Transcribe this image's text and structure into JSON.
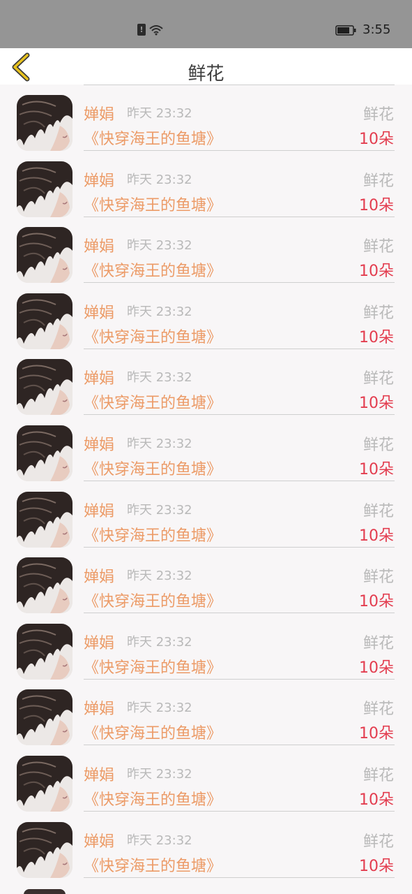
{
  "status_bar": {
    "time": "3:55"
  },
  "header": {
    "title": "鲜花"
  },
  "items": [
    {
      "user": "婵娟",
      "time": "昨天 23:32",
      "gift": "鲜花",
      "book": "《快穿海王的鱼塘》",
      "count": "10朵"
    },
    {
      "user": "婵娟",
      "time": "昨天 23:32",
      "gift": "鲜花",
      "book": "《快穿海王的鱼塘》",
      "count": "10朵"
    },
    {
      "user": "婵娟",
      "time": "昨天 23:32",
      "gift": "鲜花",
      "book": "《快穿海王的鱼塘》",
      "count": "10朵"
    },
    {
      "user": "婵娟",
      "time": "昨天 23:32",
      "gift": "鲜花",
      "book": "《快穿海王的鱼塘》",
      "count": "10朵"
    },
    {
      "user": "婵娟",
      "time": "昨天 23:32",
      "gift": "鲜花",
      "book": "《快穿海王的鱼塘》",
      "count": "10朵"
    },
    {
      "user": "婵娟",
      "time": "昨天 23:32",
      "gift": "鲜花",
      "book": "《快穿海王的鱼塘》",
      "count": "10朵"
    },
    {
      "user": "婵娟",
      "time": "昨天 23:32",
      "gift": "鲜花",
      "book": "《快穿海王的鱼塘》",
      "count": "10朵"
    },
    {
      "user": "婵娟",
      "time": "昨天 23:32",
      "gift": "鲜花",
      "book": "《快穿海王的鱼塘》",
      "count": "10朵"
    },
    {
      "user": "婵娟",
      "time": "昨天 23:32",
      "gift": "鲜花",
      "book": "《快穿海王的鱼塘》",
      "count": "10朵"
    },
    {
      "user": "婵娟",
      "time": "昨天 23:32",
      "gift": "鲜花",
      "book": "《快穿海王的鱼塘》",
      "count": "10朵"
    },
    {
      "user": "婵娟",
      "time": "昨天 23:32",
      "gift": "鲜花",
      "book": "《快穿海王的鱼塘》",
      "count": "10朵"
    },
    {
      "user": "婵娟",
      "time": "昨天 23:32",
      "gift": "鲜花",
      "book": "《快穿海王的鱼塘》",
      "count": "10朵"
    }
  ],
  "colors": {
    "accent_orange": "#ec9b67",
    "count_red": "#e33d4f",
    "muted_gray": "#b9b9b9",
    "back_chevron": "#e8c21e"
  },
  "icons": {
    "back": "chevron-left-icon",
    "status": [
      "sim-alert-icon",
      "wifi-icon",
      "battery-icon"
    ],
    "avatar": "avatar-photo"
  }
}
